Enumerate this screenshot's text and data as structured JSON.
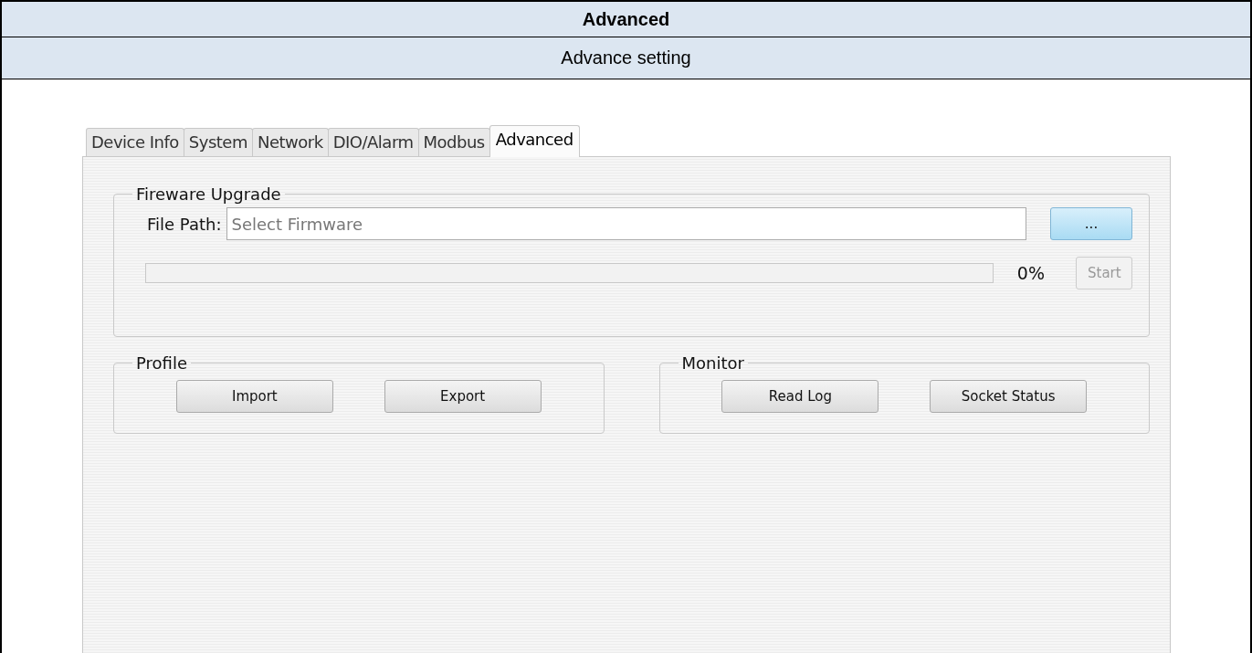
{
  "header": {
    "title": "Advanced",
    "subtitle": "Advance setting"
  },
  "tabs": [
    {
      "label": "Device Info",
      "selected": false
    },
    {
      "label": "System",
      "selected": false
    },
    {
      "label": "Network",
      "selected": false
    },
    {
      "label": "DIO/Alarm",
      "selected": false
    },
    {
      "label": "Modbus",
      "selected": false
    },
    {
      "label": "Advanced",
      "selected": true
    }
  ],
  "firmware": {
    "title": "Fireware Upgrade",
    "file_label": "File Path:",
    "placeholder": "Select Firmware",
    "browse_button": "...",
    "level": 0,
    "percent": "0%",
    "start_button": {
      "label": "Start",
      "disabled": true
    }
  },
  "profile": {
    "title": "Profile",
    "buttons": [
      "Import",
      "Export"
    ]
  },
  "monitor": {
    "title": "Monitor",
    "buttons": [
      "Read Log",
      "Socket Status"
    ]
  }
}
